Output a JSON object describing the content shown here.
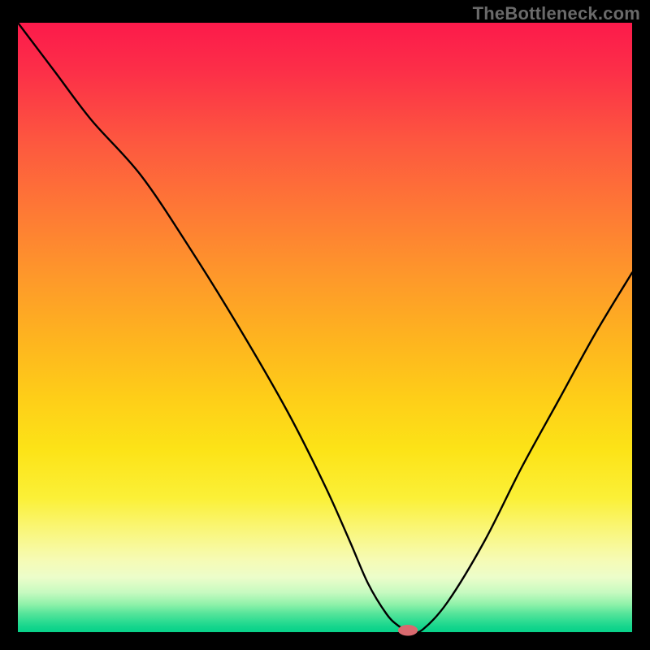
{
  "watermark": "TheBottleneck.com",
  "colors": {
    "background": "#000000",
    "curve": "#000000",
    "marker": "#d96a6f",
    "gradient_top": "#fc1a4b",
    "gradient_bottom": "#08d189"
  },
  "chart_data": {
    "type": "line",
    "title": "",
    "xlabel": "",
    "ylabel": "",
    "xlim": [
      0,
      100
    ],
    "ylim": [
      0,
      100
    ],
    "grid": false,
    "legend": false,
    "series": [
      {
        "name": "bottleneck-curve",
        "x": [
          0,
          6,
          12,
          20,
          28,
          36,
          44,
          50,
          54,
          57,
          60,
          62,
          64,
          66,
          70,
          76,
          82,
          88,
          94,
          100
        ],
        "y": [
          100,
          92,
          84,
          75,
          63,
          50,
          36,
          24,
          15,
          8,
          3,
          1,
          0,
          0.5,
          5,
          15,
          27,
          38,
          49,
          59
        ]
      }
    ],
    "marker": {
      "name": "optimal-point",
      "x": 63.5,
      "y": 0.3,
      "rx": 1.6,
      "ry": 0.9
    },
    "background_gradient": {
      "orientation": "vertical",
      "stops": [
        {
          "pos": 0.0,
          "color": "#fc1a4b"
        },
        {
          "pos": 0.2,
          "color": "#fd593f"
        },
        {
          "pos": 0.42,
          "color": "#fe992a"
        },
        {
          "pos": 0.62,
          "color": "#fecf18"
        },
        {
          "pos": 0.78,
          "color": "#fbf037"
        },
        {
          "pos": 0.88,
          "color": "#f6fbb3"
        },
        {
          "pos": 0.95,
          "color": "#8df1a9"
        },
        {
          "pos": 1.0,
          "color": "#08d189"
        }
      ]
    }
  }
}
